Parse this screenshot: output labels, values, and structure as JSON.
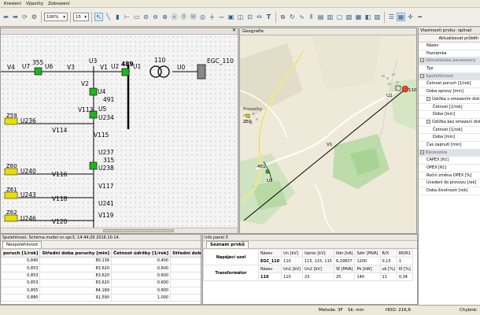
{
  "menu": [
    "Kreslení",
    "Výpočty",
    "Zobrazení"
  ],
  "toolbar": {
    "zoom_value": "100%",
    "grid_value": "15",
    "icons": [
      "back-arrow-icon",
      "forward-arrow-icon",
      "refresh-icon",
      "pointer-icon",
      "line-tool-icon",
      "transformer-tool-icon",
      "node-tool-icon",
      "busbar-tool-icon",
      "text-tool-icon",
      "grid-icon"
    ]
  },
  "schema": {
    "buses": [
      "V4",
      "U7",
      "355",
      "U6",
      "V3",
      "U3",
      "V1",
      "U2",
      "489",
      "U1",
      "110",
      "U0",
      "EGC_110",
      "V2",
      "U4",
      "491",
      "V113",
      "U5",
      "U234",
      "V115",
      "U237",
      "315",
      "U238",
      "U236",
      "V114",
      "U240",
      "V116",
      "U243",
      "V118",
      "U241",
      "V117",
      "U246",
      "V120",
      "V119"
    ],
    "boxes": [
      "Z59",
      "Z60",
      "Z61",
      "Z62"
    ]
  },
  "geo": {
    "title": "Geografie",
    "town": "Prosečky",
    "labels": [
      "U2",
      "110",
      "Z59",
      "U3",
      "V1",
      "481"
    ]
  },
  "props": {
    "title": "Vlastnosti prvku: spínač",
    "button": "Aktualizovat průběh",
    "rows": [
      {
        "text": "Název",
        "type": "normal"
      },
      {
        "text": "Poznámka",
        "type": "normal"
      },
      {
        "text": "Uživatelské parametry",
        "type": "group"
      },
      {
        "text": "Typ",
        "type": "normal"
      },
      {
        "text": "Spolehlivost",
        "type": "group"
      },
      {
        "text": "Četnost poruch [1/rok]",
        "type": "normal"
      },
      {
        "text": "Doba opravy [min]",
        "type": "normal"
      },
      {
        "text": "Údržba s omezením dist.",
        "type": "sub"
      },
      {
        "text": "Četnost [1/rok]",
        "type": "indent"
      },
      {
        "text": "Doba [min]",
        "type": "indent"
      },
      {
        "text": "Údržba bez omezení dist.",
        "type": "sub"
      },
      {
        "text": "Četnost [1/rok]",
        "type": "indent"
      },
      {
        "text": "Doba [min]",
        "type": "indent"
      },
      {
        "text": "Čas zapnutí [min]",
        "type": "normal"
      },
      {
        "text": "Ekonomie",
        "type": "group"
      },
      {
        "text": "CAPEX [Kč]",
        "type": "normal"
      },
      {
        "text": "OPEX [Kč]",
        "type": "normal"
      },
      {
        "text": "Roční změna OPEX [%]",
        "type": "normal"
      },
      {
        "text": "Uvedení do provozu [rok]",
        "type": "normal"
      },
      {
        "text": "Doba životnosti [rok]",
        "type": "normal"
      }
    ]
  },
  "reliability": {
    "title": "Spolehlivost. Schéma model vn.spc3, 14:44:29 2016.10.14.",
    "tab": "Nespolehlivost",
    "columns": [
      "poruch [1/rok]",
      "Střední doba poruchy [min]",
      "Četnost údržby [1/rok]",
      "Střední doba údržby [min]"
    ],
    "rows": [
      [
        "0,840",
        "80,136",
        "0,400",
        "300,000"
      ],
      [
        "0,853",
        "83,620",
        "0,600",
        "300,000"
      ],
      [
        "0,853",
        "83,620",
        "0,600",
        "300,000"
      ],
      [
        "0,853",
        "83,620",
        "0,600",
        "300,000"
      ],
      [
        "0,855",
        "84,189",
        "0,800",
        "300,000"
      ],
      [
        "0,880",
        "91,590",
        "1,000",
        "300,000"
      ]
    ]
  },
  "info": {
    "title": "Info panel 3",
    "tab": "Seznam prvků",
    "sections": [
      {
        "label": "Napájecí uzel",
        "header": [
          "Název",
          "Un [kV]",
          "Uprov [kV]",
          "Ikbr [kA]",
          "Szkr [MVA]",
          "R/X",
          "R0/R1"
        ],
        "values": [
          "EGC_110",
          "110",
          "115, 115, 115",
          "6,29837",
          "1200",
          "0,15",
          "1"
        ]
      },
      {
        "label": "Transformátor",
        "header": [
          "Název",
          "Un1 [kV]",
          "Un2 [kV]",
          "Sť [MVA]",
          "Pk [kW]",
          "uk [%]",
          "I0 [%]"
        ],
        "values": [
          "110",
          "110",
          "23",
          "25",
          "140",
          "11",
          "0,34"
        ]
      }
    ]
  },
  "status": {
    "method": "Metoda: 3F",
    "unit": "Sk: min",
    "hdo": "HDO: 216,6",
    "errors": "Chybné:"
  }
}
